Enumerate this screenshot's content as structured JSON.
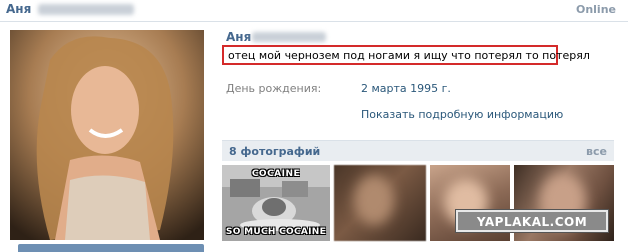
{
  "header": {
    "name": "Аня",
    "online": "Online"
  },
  "profile": {
    "name": "Аня",
    "status": "отец мой чернозем под ногами я ищу что потерял то потерял",
    "birthday_label": "День рождения:",
    "birthday_value": "2 марта 1995 г.",
    "more_info": "Показать подробную информацию"
  },
  "photos": {
    "title": "8 фотографий",
    "all": "все",
    "meme_top": "COCAINE",
    "meme_bottom": "SO MUCH COCAINE"
  },
  "watermark": "YAPLAKAL.COM",
  "colors": {
    "link": "#2b587a",
    "name": "#45688e",
    "highlight_border": "#d42a2a"
  }
}
